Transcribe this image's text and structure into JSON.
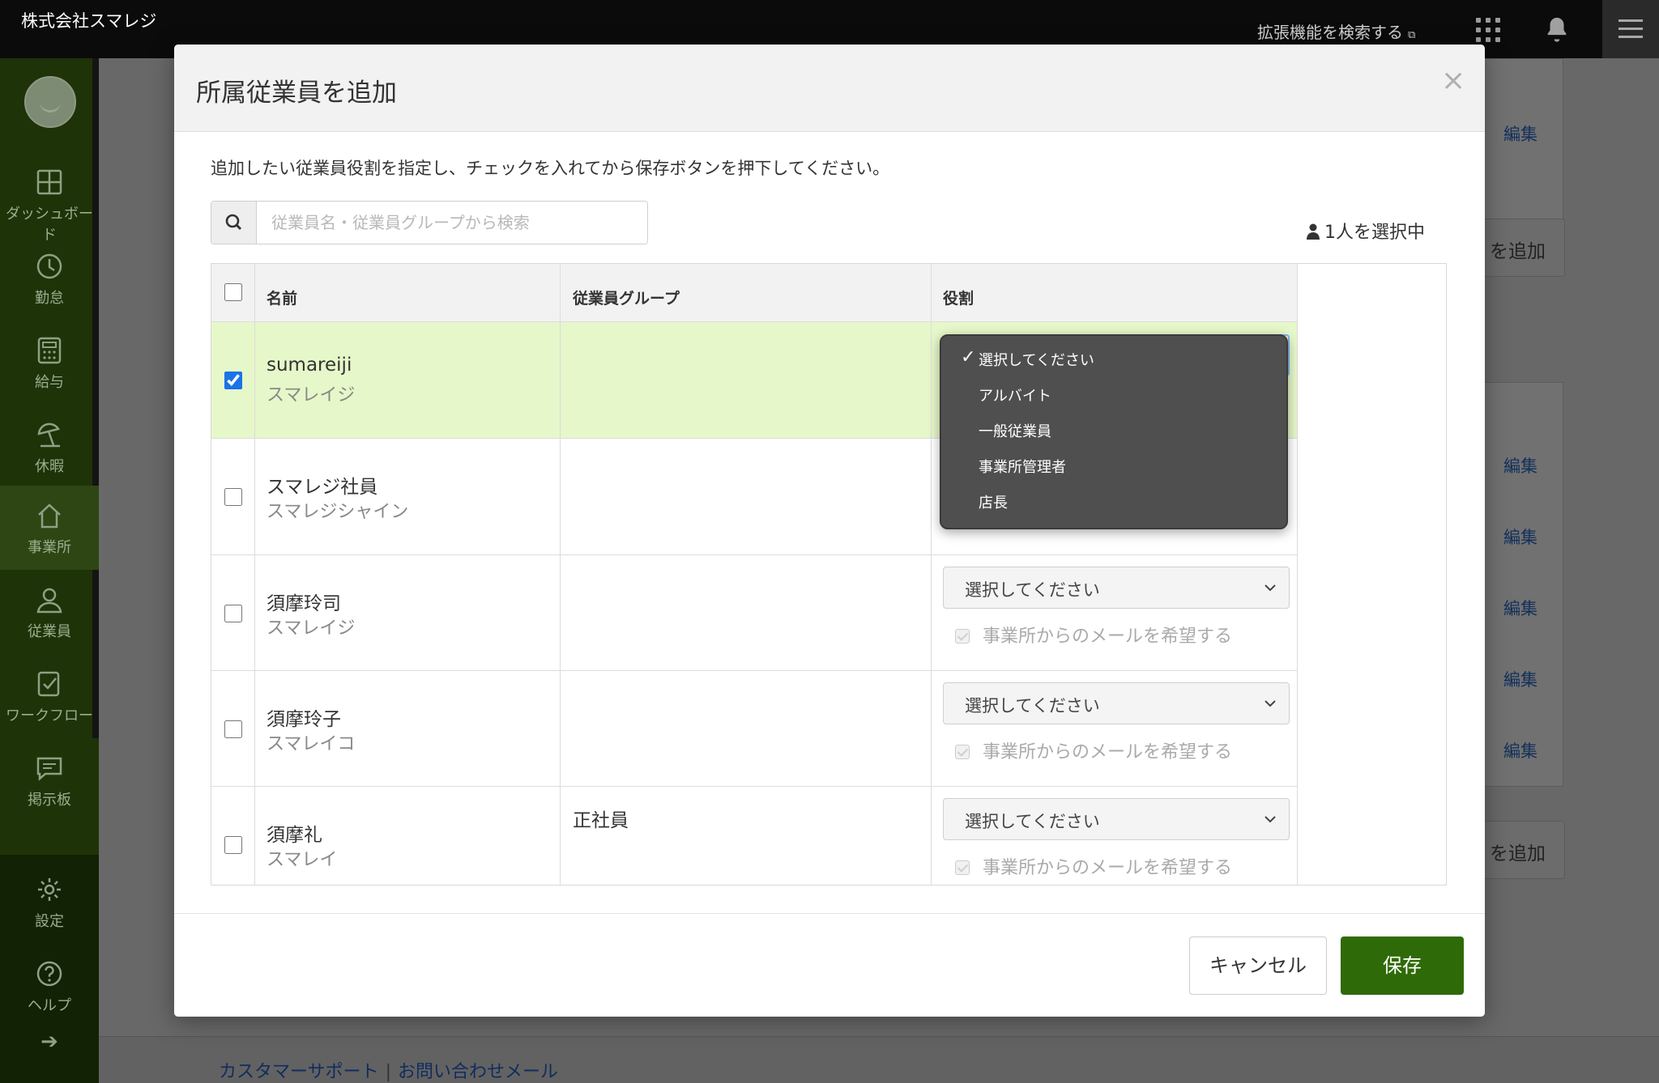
{
  "topbar": {
    "company": "株式会社スマレジ",
    "ext_search": "拡張機能を検索する"
  },
  "sidebar": {
    "items": [
      {
        "label": "ダッシュボード",
        "icon": "dashboard-icon"
      },
      {
        "label": "勤怠",
        "icon": "clock-icon"
      },
      {
        "label": "給与",
        "icon": "calculator-icon"
      },
      {
        "label": "休暇",
        "icon": "beach-umbrella-icon"
      },
      {
        "label": "事業所",
        "icon": "home-icon"
      },
      {
        "label": "従業員",
        "icon": "user-icon"
      },
      {
        "label": "ワークフロー",
        "icon": "workflow-icon"
      },
      {
        "label": "掲示板",
        "icon": "message-board-icon"
      },
      {
        "label": "設定",
        "icon": "gear-icon"
      },
      {
        "label": "ヘルプ",
        "icon": "help-icon"
      }
    ],
    "active": "事業所"
  },
  "background": {
    "edit_label": "編集",
    "add_label": "を追加",
    "footer_support": "カスタマーサポート",
    "footer_separator": "|",
    "footer_mail": "お問い合わせメール"
  },
  "modal": {
    "title": "所属従業員を追加",
    "close": "×",
    "instruction": "追加したい従業員役割を指定し、チェックを入れてから保存ボタンを押下してください。",
    "search_placeholder": "従業員名・従業員グループから検索",
    "selected_count": "1人を選択中",
    "columns": {
      "name": "名前",
      "group": "従業員グループ",
      "role": "役割"
    },
    "rows": [
      {
        "name": "sumareiji",
        "kana": "スマレイジ",
        "group": "",
        "checked": true
      },
      {
        "name": "スマレジ社員",
        "kana": "スマレジシャイン",
        "group": "",
        "checked": false
      },
      {
        "name": "須摩玲司",
        "kana": "スマレイジ",
        "group": "",
        "checked": false,
        "role": "選択してください",
        "mail": "事業所からのメールを希望する"
      },
      {
        "name": "須摩玲子",
        "kana": "スマレイコ",
        "group": "",
        "checked": false,
        "role": "選択してください",
        "mail": "事業所からのメールを希望する"
      },
      {
        "name": "須摩礼",
        "kana": "スマレイ",
        "group": "正社員",
        "checked": false,
        "role": "選択してください",
        "mail": "事業所からのメールを希望する"
      }
    ],
    "dropdown": {
      "selected": "選択してください",
      "options": [
        "選択してください",
        "アルバイト",
        "一般従業員",
        "事業所管理者",
        "店長"
      ]
    },
    "cancel_label": "キャンセル",
    "save_label": "保存"
  },
  "colors": {
    "sidebar_bg": "#1e3308",
    "selected_row": "#e6f7c9",
    "save_button": "#2f6a08",
    "link": "#12305a"
  }
}
